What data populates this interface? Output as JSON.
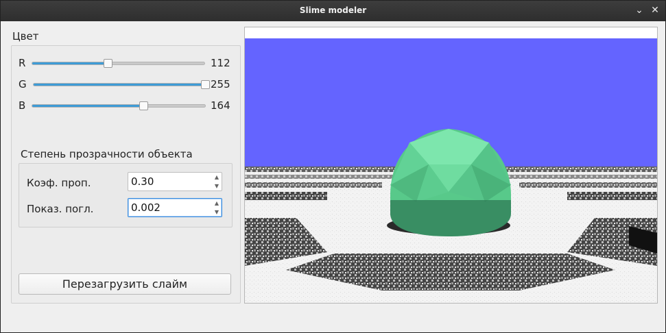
{
  "window": {
    "title": "Slime modeler",
    "minimize_glyph": "⌄",
    "close_glyph": "✕"
  },
  "color_section": {
    "label": "Цвет",
    "sliders": [
      {
        "label": "R",
        "value": "112",
        "fraction": 0.439
      },
      {
        "label": "G",
        "value": "255",
        "fraction": 1.0
      },
      {
        "label": "B",
        "value": "164",
        "fraction": 0.643
      }
    ]
  },
  "transparency_section": {
    "label": "Степень прозрачности объекта",
    "fields": [
      {
        "label": "Коэф.  проп.",
        "value": "0.30"
      },
      {
        "label": "Показ. погл.",
        "value": "0.002"
      }
    ]
  },
  "reload_button": {
    "label": "Перезагрузить слайм"
  },
  "viewport": {
    "sky_color": "#6464ff",
    "slime_color": "#70ffa4",
    "floor_light": "#f4f4f4",
    "floor_dark": "#3a3a3a"
  },
  "colors": {
    "accent": "#3d9bd6",
    "focus_border": "#3d8ee0"
  },
  "icons": {
    "minimize": "chevron-down-icon",
    "close": "close-icon",
    "spin_up": "triangle-up-icon",
    "spin_down": "triangle-down-icon"
  }
}
